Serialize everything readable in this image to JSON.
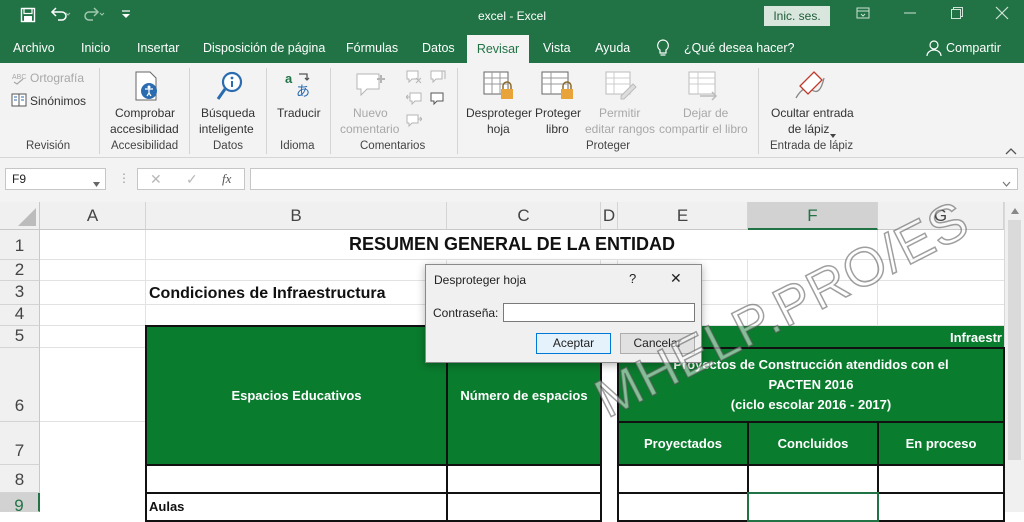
{
  "window": {
    "title": "excel  -  Excel",
    "signin": "Inic. ses."
  },
  "menu": {
    "tabs": [
      "Archivo",
      "Inicio",
      "Insertar",
      "Disposición de página",
      "Fórmulas",
      "Datos",
      "Revisar",
      "Vista",
      "Ayuda"
    ],
    "active": "Revisar",
    "tell_me": "¿Qué desea hacer?",
    "share": "Compartir"
  },
  "ribbon": {
    "revision": {
      "ortografia": "Ortografía",
      "sinonimos": "Sinónimos",
      "group": "Revisión"
    },
    "accesibilidad": {
      "btn1": "Comprobar",
      "btn2": "accesibilidad",
      "group": "Accesibilidad"
    },
    "datos": {
      "btn1": "Búsqueda",
      "btn2": "inteligente",
      "group": "Datos"
    },
    "idioma": {
      "btn": "Traducir",
      "group": "Idioma"
    },
    "comentarios": {
      "btn1": "Nuevo",
      "btn2": "comentario",
      "group": "Comentarios"
    },
    "proteger": {
      "hoja1": "Desproteger",
      "hoja2": "hoja",
      "libro1": "Proteger",
      "libro2": "libro",
      "rangos1": "Permitir",
      "rangos2": "editar rangos",
      "compartir1": "Dejar de",
      "compartir2": "compartir el libro",
      "group": "Proteger"
    },
    "lapiz": {
      "btn1": "Ocultar entrada",
      "btn2": "de lápiz",
      "group": "Entrada de lápiz"
    }
  },
  "formula_bar": {
    "name_box": "F9",
    "fx": "fx",
    "value": ""
  },
  "columns": [
    "A",
    "B",
    "C",
    "D",
    "E",
    "F",
    "G"
  ],
  "rows": [
    "1",
    "2",
    "3",
    "4",
    "5",
    "6",
    "7",
    "8",
    "9"
  ],
  "cells": {
    "title": "RESUMEN GENERAL DE LA ENTIDAD",
    "subtitle": "Condiciones de Infraestructura",
    "espacios": "Espacios Educativos",
    "numero": "Número de espacios",
    "infra": "Infraestr",
    "proyectos1": "Proyectos de Construcción atendidos con el",
    "proyectos2": "PACTEN 2016",
    "proyectos3": "(ciclo escolar 2016 - 2017)",
    "proyectados": "Proyectados",
    "concluidos": "Concluidos",
    "en_proceso": "En proceso",
    "aulas": "Aulas"
  },
  "dialog": {
    "title": "Desproteger hoja",
    "help": "?",
    "close": "✕",
    "password_label": "Contraseña:",
    "password_value": "",
    "ok": "Aceptar",
    "cancel": "Cancelar"
  },
  "watermark": "MHELP.PRO/ES",
  "colors": {
    "excel_green": "#217346",
    "header_fill": "#0a7c2e"
  }
}
